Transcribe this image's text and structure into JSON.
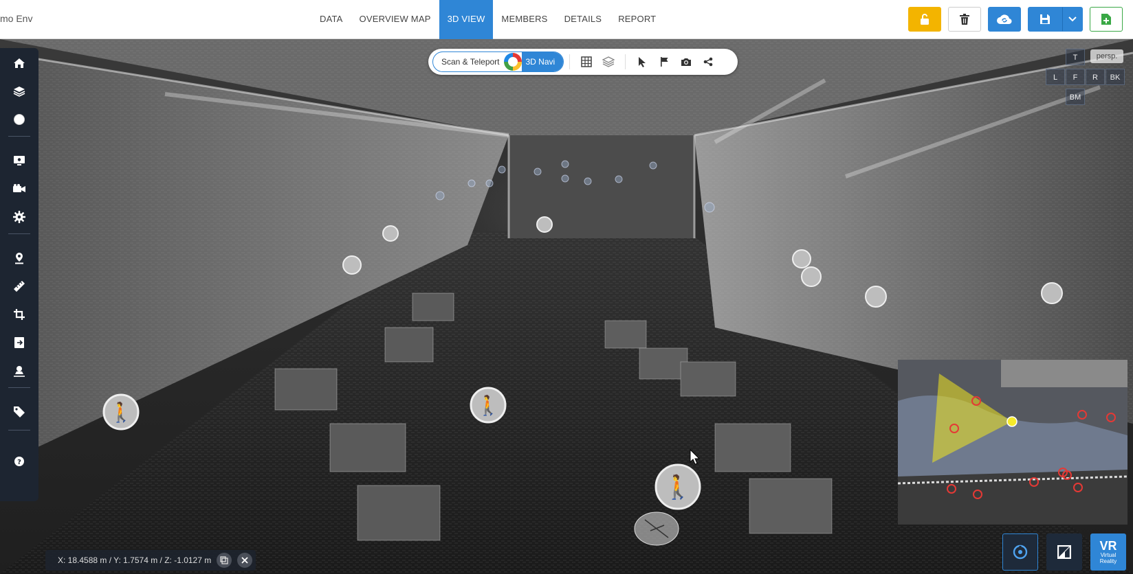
{
  "header": {
    "project_title": "mo Env",
    "tabs": [
      {
        "label": "DATA",
        "active": false
      },
      {
        "label": "OVERVIEW MAP",
        "active": false
      },
      {
        "label": "3D VIEW",
        "active": true
      },
      {
        "label": "MEMBERS",
        "active": false
      },
      {
        "label": "DETAILS",
        "active": false
      },
      {
        "label": "REPORT",
        "active": false
      }
    ],
    "actions": [
      "unlock-icon",
      "trash-icon",
      "cloud-sync-icon",
      "save-icon",
      "chevron-down-icon",
      "add-file-icon"
    ]
  },
  "toolbar": {
    "mode_scan": "Scan & Teleport",
    "mode_navi": "3D Navi",
    "tools": [
      "grid-icon",
      "layers-icon",
      "pointer-icon",
      "flag-icon",
      "camera-icon",
      "share-icon"
    ]
  },
  "sidebar": {
    "items": [
      "home-icon",
      "layers-icon",
      "sphere-icon",
      "monitor-icon",
      "video-camera-icon",
      "gear-icon",
      "location-pin-icon",
      "ruler-icon",
      "crop-icon",
      "export-icon",
      "scan-station-icon",
      "tag-icon",
      "help-icon"
    ]
  },
  "viewcube": {
    "top": "T",
    "left": "L",
    "front": "F",
    "right": "R",
    "back": "BK",
    "bottom": "BM",
    "projection": "persp."
  },
  "coordinates": {
    "text": "X: 18.4588 m / Y: 1.7574 m / Z: -1.0127 m"
  },
  "bottom_buttons": {
    "vr_line1": "VR",
    "vr_line2": "Virtual",
    "vr_line3": "Reality"
  },
  "colors": {
    "accent": "#2f86d6",
    "warning": "#f3b400",
    "success": "#39a845",
    "sidebar": "#1d2531"
  }
}
